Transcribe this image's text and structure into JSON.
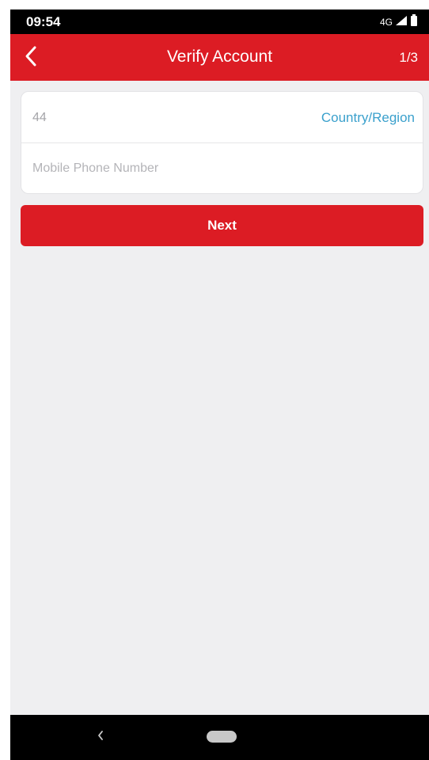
{
  "status_bar": {
    "time": "09:54",
    "network": "4G"
  },
  "app_bar": {
    "title": "Verify Account",
    "step": "1/3",
    "back_icon": "chevron-left-icon"
  },
  "form": {
    "country_code": "44",
    "country_region_label": "Country/Region",
    "phone_placeholder": "Mobile Phone Number",
    "phone_value": ""
  },
  "actions": {
    "next_label": "Next"
  },
  "colors": {
    "brand_red": "#dc1c24",
    "link_blue": "#3aa0cc",
    "background": "#efeff1"
  }
}
